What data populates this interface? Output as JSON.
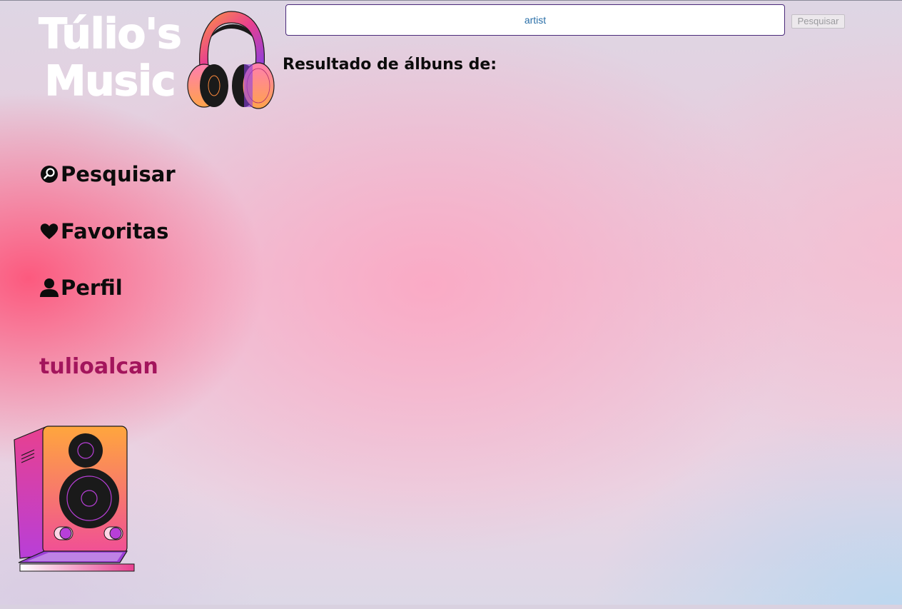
{
  "logo": {
    "line1": "Túlio's",
    "line2": "Music",
    "headphones_icon": "headphones-icon",
    "speaker_icon": "speaker-icon"
  },
  "nav": {
    "items": [
      {
        "label": "Pesquisar",
        "icon": "search-icon"
      },
      {
        "label": "Favoritas",
        "icon": "heart-icon"
      },
      {
        "label": "Perfil",
        "icon": "user-icon"
      }
    ]
  },
  "user": {
    "name": "tulioalcan"
  },
  "search": {
    "value": "artist",
    "button_label": "Pesquisar"
  },
  "results": {
    "title": "Resultado de álbuns de:"
  },
  "colors": {
    "username": "#a3155c",
    "text": "#0c0c0c",
    "accent_pink": "#e8408f",
    "accent_orange": "#ffa040",
    "accent_purple": "#9b3fd6"
  }
}
